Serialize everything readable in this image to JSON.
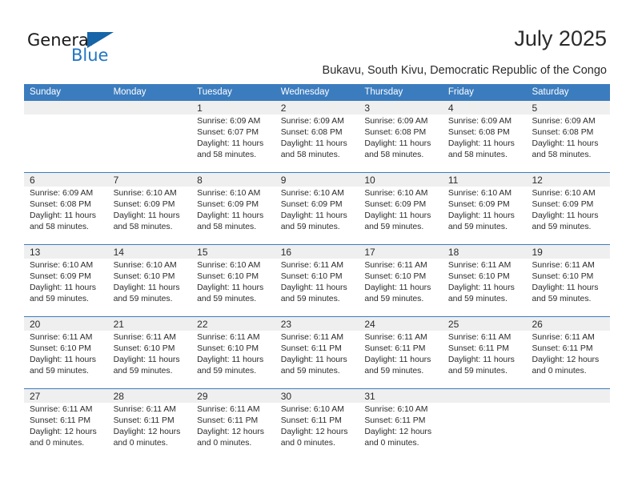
{
  "brand": {
    "name_top": "General",
    "name_bottom": "Blue",
    "accent_color": "#2175c4",
    "triangle_color": "#1565a8",
    "logo_icon": "triangle-icon"
  },
  "header": {
    "month_title": "July 2025",
    "location": "Bukavu, South Kivu, Democratic Republic of the Congo"
  },
  "theme": {
    "header_row_bg": "#3b7cbe",
    "header_row_text": "#ffffff",
    "date_strip_bg": "#efefef",
    "week_rule": "#3b7cbe",
    "body_text": "#2b2b2b"
  },
  "calendar": {
    "weekday_headers": [
      "Sunday",
      "Monday",
      "Tuesday",
      "Wednesday",
      "Thursday",
      "Friday",
      "Saturday"
    ],
    "weeks": [
      [
        {
          "day": "",
          "empty": true,
          "sunrise": "",
          "sunset": "",
          "daylight_a": "",
          "daylight_b": ""
        },
        {
          "day": "",
          "empty": true,
          "sunrise": "",
          "sunset": "",
          "daylight_a": "",
          "daylight_b": ""
        },
        {
          "day": "1",
          "empty": false,
          "sunrise": "Sunrise: 6:09 AM",
          "sunset": "Sunset: 6:07 PM",
          "daylight_a": "Daylight: 11 hours",
          "daylight_b": "and 58 minutes."
        },
        {
          "day": "2",
          "empty": false,
          "sunrise": "Sunrise: 6:09 AM",
          "sunset": "Sunset: 6:08 PM",
          "daylight_a": "Daylight: 11 hours",
          "daylight_b": "and 58 minutes."
        },
        {
          "day": "3",
          "empty": false,
          "sunrise": "Sunrise: 6:09 AM",
          "sunset": "Sunset: 6:08 PM",
          "daylight_a": "Daylight: 11 hours",
          "daylight_b": "and 58 minutes."
        },
        {
          "day": "4",
          "empty": false,
          "sunrise": "Sunrise: 6:09 AM",
          "sunset": "Sunset: 6:08 PM",
          "daylight_a": "Daylight: 11 hours",
          "daylight_b": "and 58 minutes."
        },
        {
          "day": "5",
          "empty": false,
          "sunrise": "Sunrise: 6:09 AM",
          "sunset": "Sunset: 6:08 PM",
          "daylight_a": "Daylight: 11 hours",
          "daylight_b": "and 58 minutes."
        }
      ],
      [
        {
          "day": "6",
          "empty": false,
          "sunrise": "Sunrise: 6:09 AM",
          "sunset": "Sunset: 6:08 PM",
          "daylight_a": "Daylight: 11 hours",
          "daylight_b": "and 58 minutes."
        },
        {
          "day": "7",
          "empty": false,
          "sunrise": "Sunrise: 6:10 AM",
          "sunset": "Sunset: 6:09 PM",
          "daylight_a": "Daylight: 11 hours",
          "daylight_b": "and 58 minutes."
        },
        {
          "day": "8",
          "empty": false,
          "sunrise": "Sunrise: 6:10 AM",
          "sunset": "Sunset: 6:09 PM",
          "daylight_a": "Daylight: 11 hours",
          "daylight_b": "and 58 minutes."
        },
        {
          "day": "9",
          "empty": false,
          "sunrise": "Sunrise: 6:10 AM",
          "sunset": "Sunset: 6:09 PM",
          "daylight_a": "Daylight: 11 hours",
          "daylight_b": "and 59 minutes."
        },
        {
          "day": "10",
          "empty": false,
          "sunrise": "Sunrise: 6:10 AM",
          "sunset": "Sunset: 6:09 PM",
          "daylight_a": "Daylight: 11 hours",
          "daylight_b": "and 59 minutes."
        },
        {
          "day": "11",
          "empty": false,
          "sunrise": "Sunrise: 6:10 AM",
          "sunset": "Sunset: 6:09 PM",
          "daylight_a": "Daylight: 11 hours",
          "daylight_b": "and 59 minutes."
        },
        {
          "day": "12",
          "empty": false,
          "sunrise": "Sunrise: 6:10 AM",
          "sunset": "Sunset: 6:09 PM",
          "daylight_a": "Daylight: 11 hours",
          "daylight_b": "and 59 minutes."
        }
      ],
      [
        {
          "day": "13",
          "empty": false,
          "sunrise": "Sunrise: 6:10 AM",
          "sunset": "Sunset: 6:09 PM",
          "daylight_a": "Daylight: 11 hours",
          "daylight_b": "and 59 minutes."
        },
        {
          "day": "14",
          "empty": false,
          "sunrise": "Sunrise: 6:10 AM",
          "sunset": "Sunset: 6:10 PM",
          "daylight_a": "Daylight: 11 hours",
          "daylight_b": "and 59 minutes."
        },
        {
          "day": "15",
          "empty": false,
          "sunrise": "Sunrise: 6:10 AM",
          "sunset": "Sunset: 6:10 PM",
          "daylight_a": "Daylight: 11 hours",
          "daylight_b": "and 59 minutes."
        },
        {
          "day": "16",
          "empty": false,
          "sunrise": "Sunrise: 6:11 AM",
          "sunset": "Sunset: 6:10 PM",
          "daylight_a": "Daylight: 11 hours",
          "daylight_b": "and 59 minutes."
        },
        {
          "day": "17",
          "empty": false,
          "sunrise": "Sunrise: 6:11 AM",
          "sunset": "Sunset: 6:10 PM",
          "daylight_a": "Daylight: 11 hours",
          "daylight_b": "and 59 minutes."
        },
        {
          "day": "18",
          "empty": false,
          "sunrise": "Sunrise: 6:11 AM",
          "sunset": "Sunset: 6:10 PM",
          "daylight_a": "Daylight: 11 hours",
          "daylight_b": "and 59 minutes."
        },
        {
          "day": "19",
          "empty": false,
          "sunrise": "Sunrise: 6:11 AM",
          "sunset": "Sunset: 6:10 PM",
          "daylight_a": "Daylight: 11 hours",
          "daylight_b": "and 59 minutes."
        }
      ],
      [
        {
          "day": "20",
          "empty": false,
          "sunrise": "Sunrise: 6:11 AM",
          "sunset": "Sunset: 6:10 PM",
          "daylight_a": "Daylight: 11 hours",
          "daylight_b": "and 59 minutes."
        },
        {
          "day": "21",
          "empty": false,
          "sunrise": "Sunrise: 6:11 AM",
          "sunset": "Sunset: 6:10 PM",
          "daylight_a": "Daylight: 11 hours",
          "daylight_b": "and 59 minutes."
        },
        {
          "day": "22",
          "empty": false,
          "sunrise": "Sunrise: 6:11 AM",
          "sunset": "Sunset: 6:10 PM",
          "daylight_a": "Daylight: 11 hours",
          "daylight_b": "and 59 minutes."
        },
        {
          "day": "23",
          "empty": false,
          "sunrise": "Sunrise: 6:11 AM",
          "sunset": "Sunset: 6:11 PM",
          "daylight_a": "Daylight: 11 hours",
          "daylight_b": "and 59 minutes."
        },
        {
          "day": "24",
          "empty": false,
          "sunrise": "Sunrise: 6:11 AM",
          "sunset": "Sunset: 6:11 PM",
          "daylight_a": "Daylight: 11 hours",
          "daylight_b": "and 59 minutes."
        },
        {
          "day": "25",
          "empty": false,
          "sunrise": "Sunrise: 6:11 AM",
          "sunset": "Sunset: 6:11 PM",
          "daylight_a": "Daylight: 11 hours",
          "daylight_b": "and 59 minutes."
        },
        {
          "day": "26",
          "empty": false,
          "sunrise": "Sunrise: 6:11 AM",
          "sunset": "Sunset: 6:11 PM",
          "daylight_a": "Daylight: 12 hours",
          "daylight_b": "and 0 minutes."
        }
      ],
      [
        {
          "day": "27",
          "empty": false,
          "sunrise": "Sunrise: 6:11 AM",
          "sunset": "Sunset: 6:11 PM",
          "daylight_a": "Daylight: 12 hours",
          "daylight_b": "and 0 minutes."
        },
        {
          "day": "28",
          "empty": false,
          "sunrise": "Sunrise: 6:11 AM",
          "sunset": "Sunset: 6:11 PM",
          "daylight_a": "Daylight: 12 hours",
          "daylight_b": "and 0 minutes."
        },
        {
          "day": "29",
          "empty": false,
          "sunrise": "Sunrise: 6:11 AM",
          "sunset": "Sunset: 6:11 PM",
          "daylight_a": "Daylight: 12 hours",
          "daylight_b": "and 0 minutes."
        },
        {
          "day": "30",
          "empty": false,
          "sunrise": "Sunrise: 6:10 AM",
          "sunset": "Sunset: 6:11 PM",
          "daylight_a": "Daylight: 12 hours",
          "daylight_b": "and 0 minutes."
        },
        {
          "day": "31",
          "empty": false,
          "sunrise": "Sunrise: 6:10 AM",
          "sunset": "Sunset: 6:11 PM",
          "daylight_a": "Daylight: 12 hours",
          "daylight_b": "and 0 minutes."
        },
        {
          "day": "",
          "empty": true,
          "sunrise": "",
          "sunset": "",
          "daylight_a": "",
          "daylight_b": ""
        },
        {
          "day": "",
          "empty": true,
          "sunrise": "",
          "sunset": "",
          "daylight_a": "",
          "daylight_b": ""
        }
      ]
    ]
  }
}
